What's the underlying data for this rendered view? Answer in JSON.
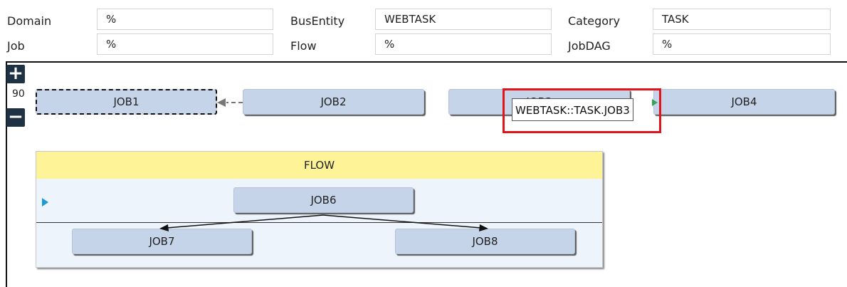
{
  "filters": {
    "domain": {
      "label": "Domain",
      "value": "%"
    },
    "bus_entity": {
      "label": "BusEntity",
      "value": "WEBTASK"
    },
    "category": {
      "label": "Category",
      "value": "TASK"
    },
    "job": {
      "label": "Job",
      "value": "%"
    },
    "flow": {
      "label": "Flow",
      "value": "%"
    },
    "job_dag": {
      "label": "JobDAG",
      "value": "%"
    }
  },
  "zoom": {
    "plus_icon": "+",
    "minus_icon": "−",
    "level": "90"
  },
  "jobs": {
    "job1": "JOB1",
    "job2": "JOB2",
    "job3": "JOB3",
    "job4": "JOB4",
    "job6": "JOB6",
    "job7": "JOB7",
    "job8": "JOB8"
  },
  "flow": {
    "title": "FLOW"
  },
  "tooltip": {
    "text": "WEBTASK::TASK.JOB3"
  },
  "colors": {
    "job_fill": "#c5d4e8",
    "flow_header": "#fef497",
    "highlight": "#e0151b",
    "zoom_button": "#1f3244"
  }
}
